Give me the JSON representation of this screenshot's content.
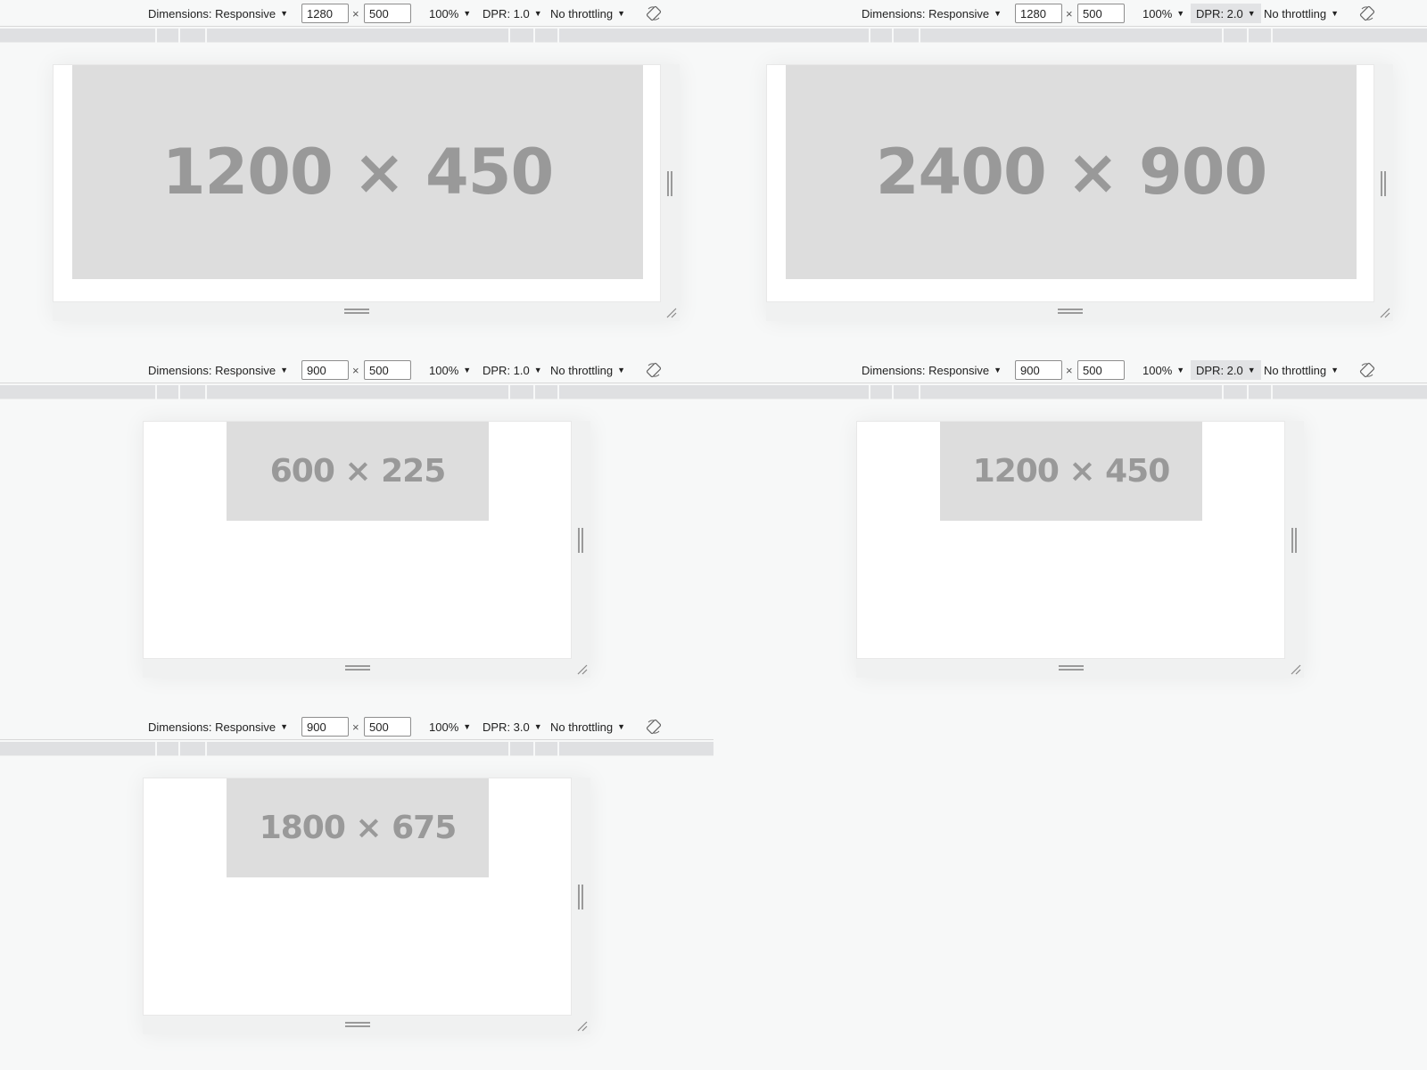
{
  "panels": [
    {
      "toolbar": {
        "dimensions_label": "Dimensions: Responsive",
        "width_value": "1280",
        "height_value": "500",
        "times": "×",
        "zoom_label": "100%",
        "dpr_label": "DPR: 1.0",
        "dpr_active": false,
        "throttling_label": "No throttling",
        "rotate_icon": "rotate-icon"
      },
      "placeholder_text": "1200 × 450"
    },
    {
      "toolbar": {
        "dimensions_label": "Dimensions: Responsive",
        "width_value": "1280",
        "height_value": "500",
        "times": "×",
        "zoom_label": "100%",
        "dpr_label": "DPR: 2.0",
        "dpr_active": true,
        "throttling_label": "No throttling",
        "rotate_icon": "rotate-icon"
      },
      "placeholder_text": "2400 × 900"
    },
    {
      "toolbar": {
        "dimensions_label": "Dimensions: Responsive",
        "width_value": "900",
        "height_value": "500",
        "times": "×",
        "zoom_label": "100%",
        "dpr_label": "DPR: 1.0",
        "dpr_active": false,
        "throttling_label": "No throttling",
        "rotate_icon": "rotate-icon"
      },
      "placeholder_text": "600 × 225"
    },
    {
      "toolbar": {
        "dimensions_label": "Dimensions: Responsive",
        "width_value": "900",
        "height_value": "500",
        "times": "×",
        "zoom_label": "100%",
        "dpr_label": "DPR: 2.0",
        "dpr_active": true,
        "throttling_label": "No throttling",
        "rotate_icon": "rotate-icon"
      },
      "placeholder_text": "1200 × 450"
    },
    {
      "toolbar": {
        "dimensions_label": "Dimensions: Responsive",
        "width_value": "900",
        "height_value": "500",
        "times": "×",
        "zoom_label": "100%",
        "dpr_label": "DPR: 3.0",
        "dpr_active": false,
        "throttling_label": "No throttling",
        "rotate_icon": "rotate-icon"
      },
      "placeholder_text": "1800 × 675"
    }
  ],
  "colors": {
    "background": "#f7f8f8",
    "ruler": "#dfe0e2",
    "placeholder_bg": "#dddddd",
    "placeholder_text": "#999999",
    "active_item": "#e2e3e5"
  }
}
